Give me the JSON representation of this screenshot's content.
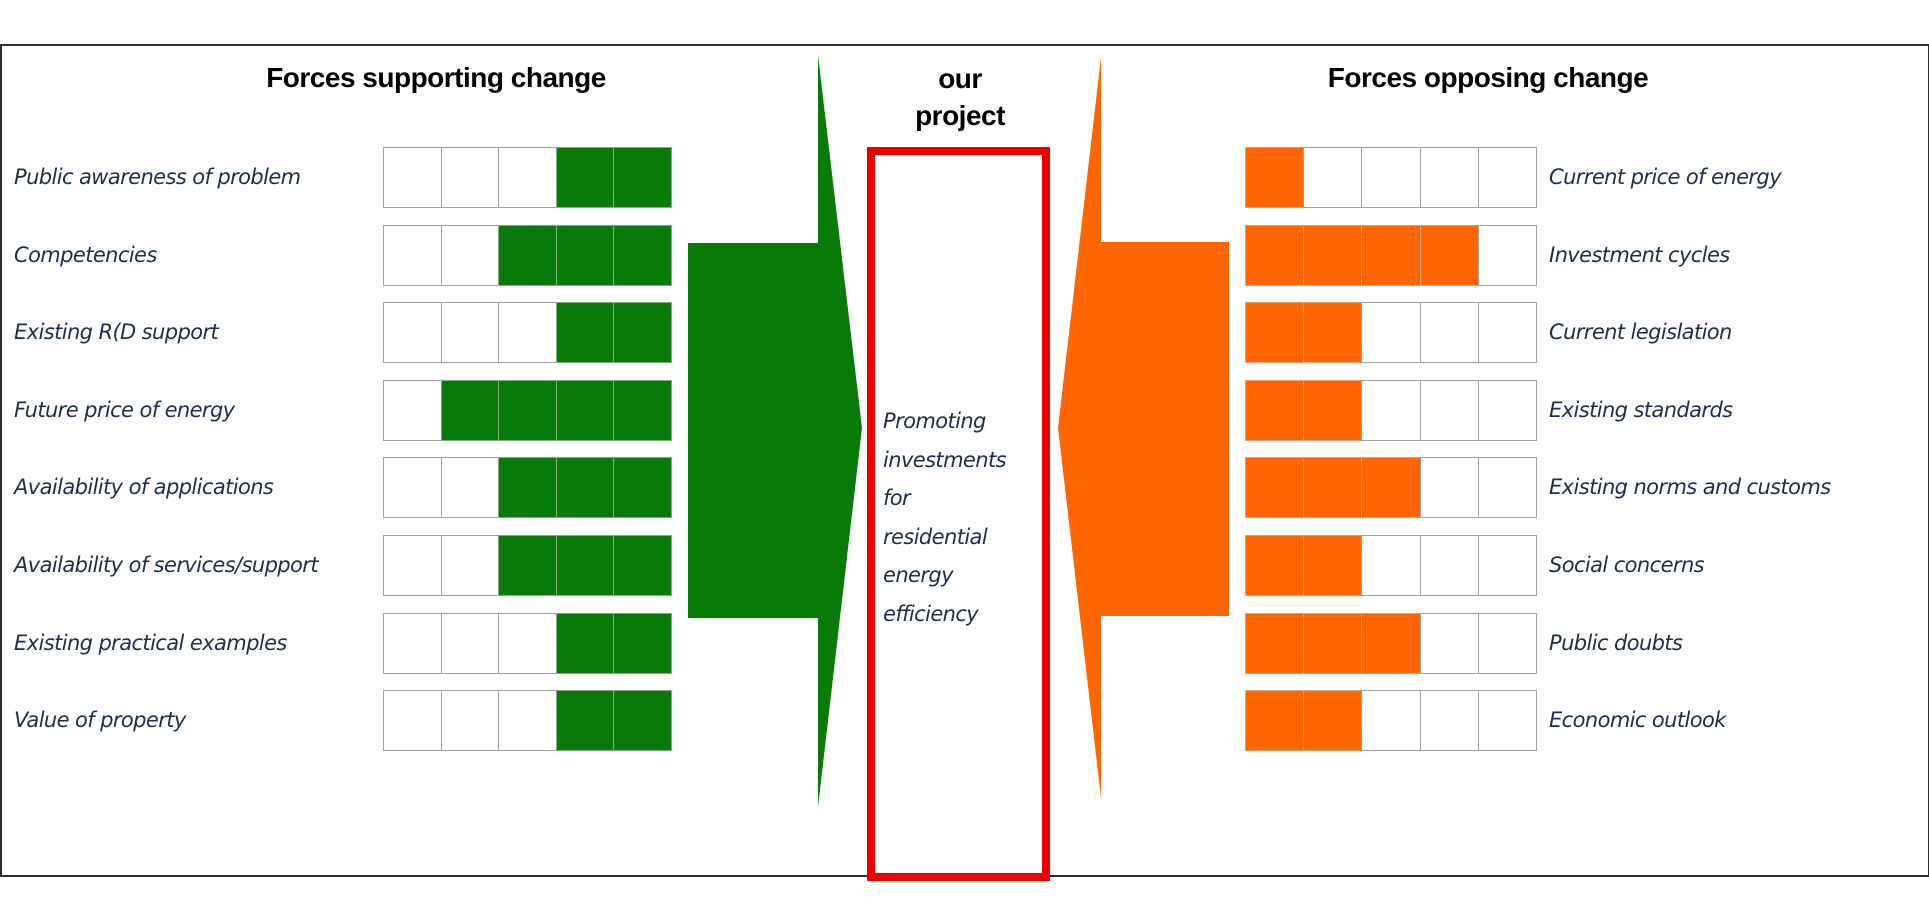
{
  "diagram": {
    "type": "force-field-analysis",
    "center": {
      "title_lines": [
        "our",
        "project"
      ],
      "description_lines": [
        "Promoting",
        "investments",
        "for",
        "residential",
        "energy",
        "efficiency"
      ],
      "box_color": "#ee0000"
    },
    "scale_max": 5,
    "supporting": {
      "title": "Forces supporting change",
      "color": "#087a08",
      "arrow_direction": "right",
      "forces": [
        {
          "label": "Public awareness of  problem",
          "strength": 2
        },
        {
          "label": "Competencies",
          "strength": 3
        },
        {
          "label": "Existing R(D support",
          "strength": 2
        },
        {
          "label": "Future price of energy",
          "strength": 4
        },
        {
          "label": "Availability of applications",
          "strength": 3
        },
        {
          "label": "Availability of services/support",
          "strength": 3
        },
        {
          "label": "Existing practical examples",
          "strength": 2
        },
        {
          "label": "Value of property",
          "strength": 2
        }
      ]
    },
    "opposing": {
      "title": "Forces opposing change",
      "color": "#ff6600",
      "arrow_direction": "left",
      "forces": [
        {
          "label": "Current price of energy",
          "strength": 1
        },
        {
          "label": "Investment cycles",
          "strength": 4
        },
        {
          "label": "Current legislation",
          "strength": 2
        },
        {
          "label": "Existing standards",
          "strength": 2
        },
        {
          "label": "Existing norms and customs",
          "strength": 3
        },
        {
          "label": "Social concerns",
          "strength": 2
        },
        {
          "label": "Public doubts",
          "strength": 3
        },
        {
          "label": "Economic outlook",
          "strength": 2
        }
      ]
    }
  }
}
